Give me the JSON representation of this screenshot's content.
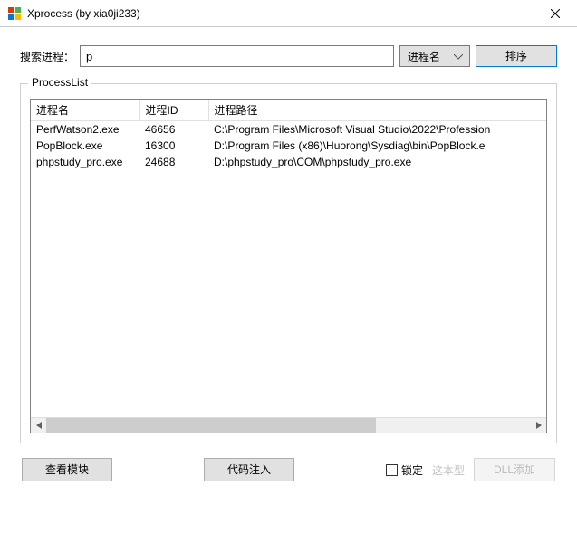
{
  "window": {
    "title": "Xprocess (by xia0ji233)"
  },
  "search": {
    "label": "搜索进程：",
    "value": "p",
    "sort_by_selected": "进程名",
    "sort_button_label": "排序"
  },
  "group": {
    "legend": "ProcessList"
  },
  "columns": {
    "name": "进程名",
    "pid": "进程ID",
    "path": "进程路径"
  },
  "processes": [
    {
      "name": "PerfWatson2.exe",
      "pid": "46656",
      "path": "C:\\Program Files\\Microsoft Visual Studio\\2022\\Profession"
    },
    {
      "name": "PopBlock.exe",
      "pid": "16300",
      "path": "D:\\Program Files (x86)\\Huorong\\Sysdiag\\bin\\PopBlock.e"
    },
    {
      "name": "phpstudy_pro.exe",
      "pid": "24688",
      "path": "D:\\phpstudy_pro\\COM\\phpstudy_pro.exe"
    }
  ],
  "buttons": {
    "view_module": "查看模块",
    "inject_code": "代码注入",
    "lock_checkbox_label": "锁定",
    "ghost_button_text": "DLL添加"
  },
  "watermark_fragment": "这本型"
}
